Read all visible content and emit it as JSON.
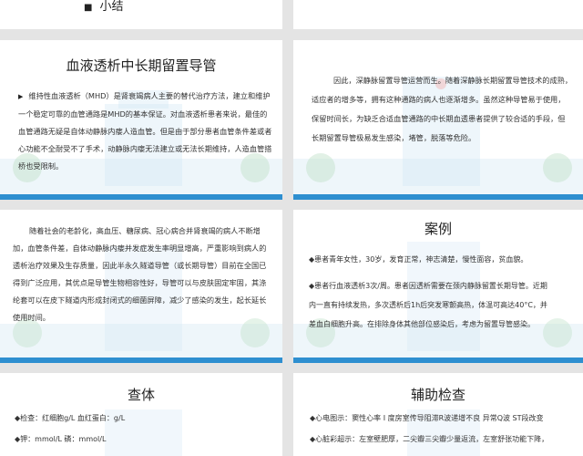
{
  "colors": {
    "bottom_bar": "#2e8fd0",
    "scene_building": "#cfe6f4",
    "scene_tree": "#bfe1c8",
    "scene_ground": "#e3f0f6"
  },
  "slide0": {
    "bullet": "■",
    "title": "小结"
  },
  "slide1": {
    "title": "血液透析中长期留置导管",
    "bullet": "▶",
    "paragraph": "维持性血液透析（MHD）是肾衰竭病人主要的替代治疗方法，建立和维护一个稳定可靠的血管通路是MHD的基本保证。对血液透析患者来说，最佳的血管通路无疑是自体动静脉内瘘人造血管。但是由于部分患者血管条件差或者心功能不全耐受不了手术，动静脉内瘘无法建立或无法长期维持，人造血管搭桥也受限制。"
  },
  "slide2": {
    "paragraph": "因此，深静脉留置导管运营而生。随着深静脉长期留置导管技术的成熟，适应者的增多等，拥有这种通路的病人也逐渐增多。虽然这种导管易于使用，保留时间长，为缺乏合适血管通路的中长期血透患者提供了较合适的手段，但长期留置导管极易发生感染，堵管，脱落等危险。"
  },
  "slide3": {
    "paragraph": "随着社会的老龄化，高血压、糖尿病、冠心病合并肾衰竭的病人不断增加，血管条件差，自体动静脉内瘘并发症发生率明显增高，严重影响到病人的透析治疗效果及生存质量，因此半永久隧道导管（或长期导管）目前在全国已得到广泛应用，其优点是导管生物相容性好，导管可以与皮肤固定牢固，其涤纶套可以在皮下隧道内形成封闭式的细菌屏障，减少了感染的发生，起长延长使用时间。"
  },
  "slide4": {
    "title": "案例",
    "lines": [
      "◆患者青年女性，30岁，发育正常，神志清楚，慢性面容，贫血貌。",
      "◆患者行血液透析3次/周。患者因透析需要在颈内静脉留置长期导管。近期",
      "内一直有持续发热，多次透析后1h后突发寒颤高热，体温可高达40°C，并",
      "差血白细胞升高。在排除身体其他部位感染后，考虑为留置导管感染。"
    ]
  },
  "slide5": {
    "title": "查体",
    "lines": [
      "◆检查：红细胞g/L 血红蛋白：g/L",
      "◆钾：mmol/L 磷：mmol/L"
    ]
  },
  "slide6": {
    "title": "辅助检查",
    "lines": [
      "◆心电图示：窦性心率 I 度房室传导阻滞R波递增不良 异常Q波 ST段改变",
      "◆心脏彩超示：左室壁肥厚，二尖瓣三尖瓣少量返流，左室舒张功能下降，"
    ]
  }
}
